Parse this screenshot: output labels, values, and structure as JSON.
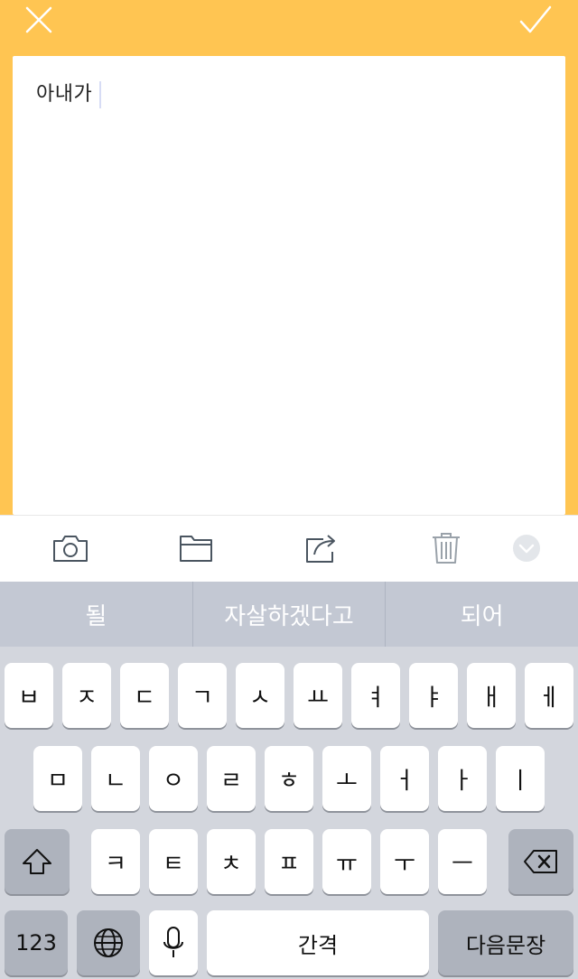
{
  "header": {
    "close_icon": "close-icon",
    "done_icon": "checkmark-icon"
  },
  "note": {
    "text": "아내가"
  },
  "toolbar": {
    "items": [
      "camera-icon",
      "folder-icon",
      "share-icon",
      "trash-icon",
      "collapse-icon"
    ]
  },
  "keyboard": {
    "suggestions": [
      "될",
      "자살하겠다고",
      "되어"
    ],
    "row1": [
      "ㅂ",
      "ㅈ",
      "ㄷ",
      "ㄱ",
      "ㅅ",
      "ㅛ",
      "ㅕ",
      "ㅑ",
      "ㅐ",
      "ㅔ"
    ],
    "row2": [
      "ㅁ",
      "ㄴ",
      "ㅇ",
      "ㄹ",
      "ㅎ",
      "ㅗ",
      "ㅓ",
      "ㅏ",
      "ㅣ"
    ],
    "row3": [
      "ㅋ",
      "ㅌ",
      "ㅊ",
      "ㅍ",
      "ㅠ",
      "ㅜ",
      "ㅡ"
    ],
    "numbers_label": "123",
    "space_label": "간격",
    "return_label": "다음문장"
  },
  "colors": {
    "accent": "#ffc552",
    "keyboard_bg": "#d3d6dd",
    "suggestion_bar": "#c3c8d3"
  }
}
